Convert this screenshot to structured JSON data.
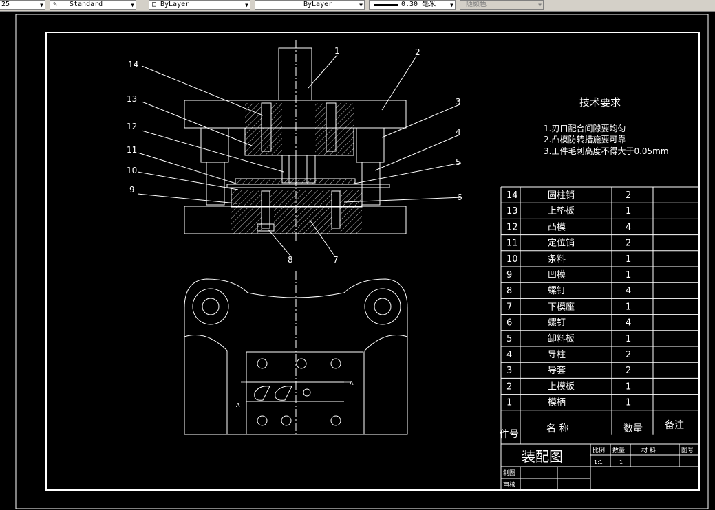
{
  "toolbar": {
    "layer_dropdown": "25",
    "text_style": "Standard",
    "color": "ByLayer",
    "linetype": "ByLayer",
    "lineweight": "0.30 毫米",
    "plot_style": "随颜色"
  },
  "drawing": {
    "tech_req": {
      "title": "技术要求",
      "items": [
        "1.刃口配合间隙要均匀",
        "2.凸模防转措施要可靠",
        "3.工件毛刺高度不得大于0.05mm"
      ]
    },
    "callouts": [
      "1",
      "2",
      "3",
      "4",
      "5",
      "6",
      "7",
      "8",
      "9",
      "10",
      "11",
      "12",
      "13",
      "14"
    ],
    "section_marker": "A",
    "parts": [
      {
        "no": "14",
        "name": "圆柱销",
        "qty": "2"
      },
      {
        "no": "13",
        "name": "上垫板",
        "qty": "1"
      },
      {
        "no": "12",
        "name": "凸模",
        "qty": "4"
      },
      {
        "no": "11",
        "name": "定位销",
        "qty": "2"
      },
      {
        "no": "10",
        "name": "条料",
        "qty": "1"
      },
      {
        "no": "9",
        "name": "凹模",
        "qty": "1"
      },
      {
        "no": "8",
        "name": "螺钉",
        "qty": "4"
      },
      {
        "no": "7",
        "name": "下模座",
        "qty": "1"
      },
      {
        "no": "6",
        "name": "螺钉",
        "qty": "4"
      },
      {
        "no": "5",
        "name": "卸料板",
        "qty": "1"
      },
      {
        "no": "4",
        "name": "导柱",
        "qty": "2"
      },
      {
        "no": "3",
        "name": "导套",
        "qty": "2"
      },
      {
        "no": "2",
        "name": "上模板",
        "qty": "1"
      },
      {
        "no": "1",
        "name": "模柄",
        "qty": "1"
      }
    ],
    "header": {
      "no": "件号",
      "name": "名 称",
      "qty": "数量",
      "remark": "备注"
    },
    "title_block": {
      "title": "装配图",
      "scale_label": "比例",
      "qty_label": "数量",
      "material_label": "材 料",
      "drawing_no_label": "图号",
      "scale_value": "1:1",
      "qty_value": "1",
      "drawn_label": "制图",
      "checked_label": "审核"
    }
  }
}
